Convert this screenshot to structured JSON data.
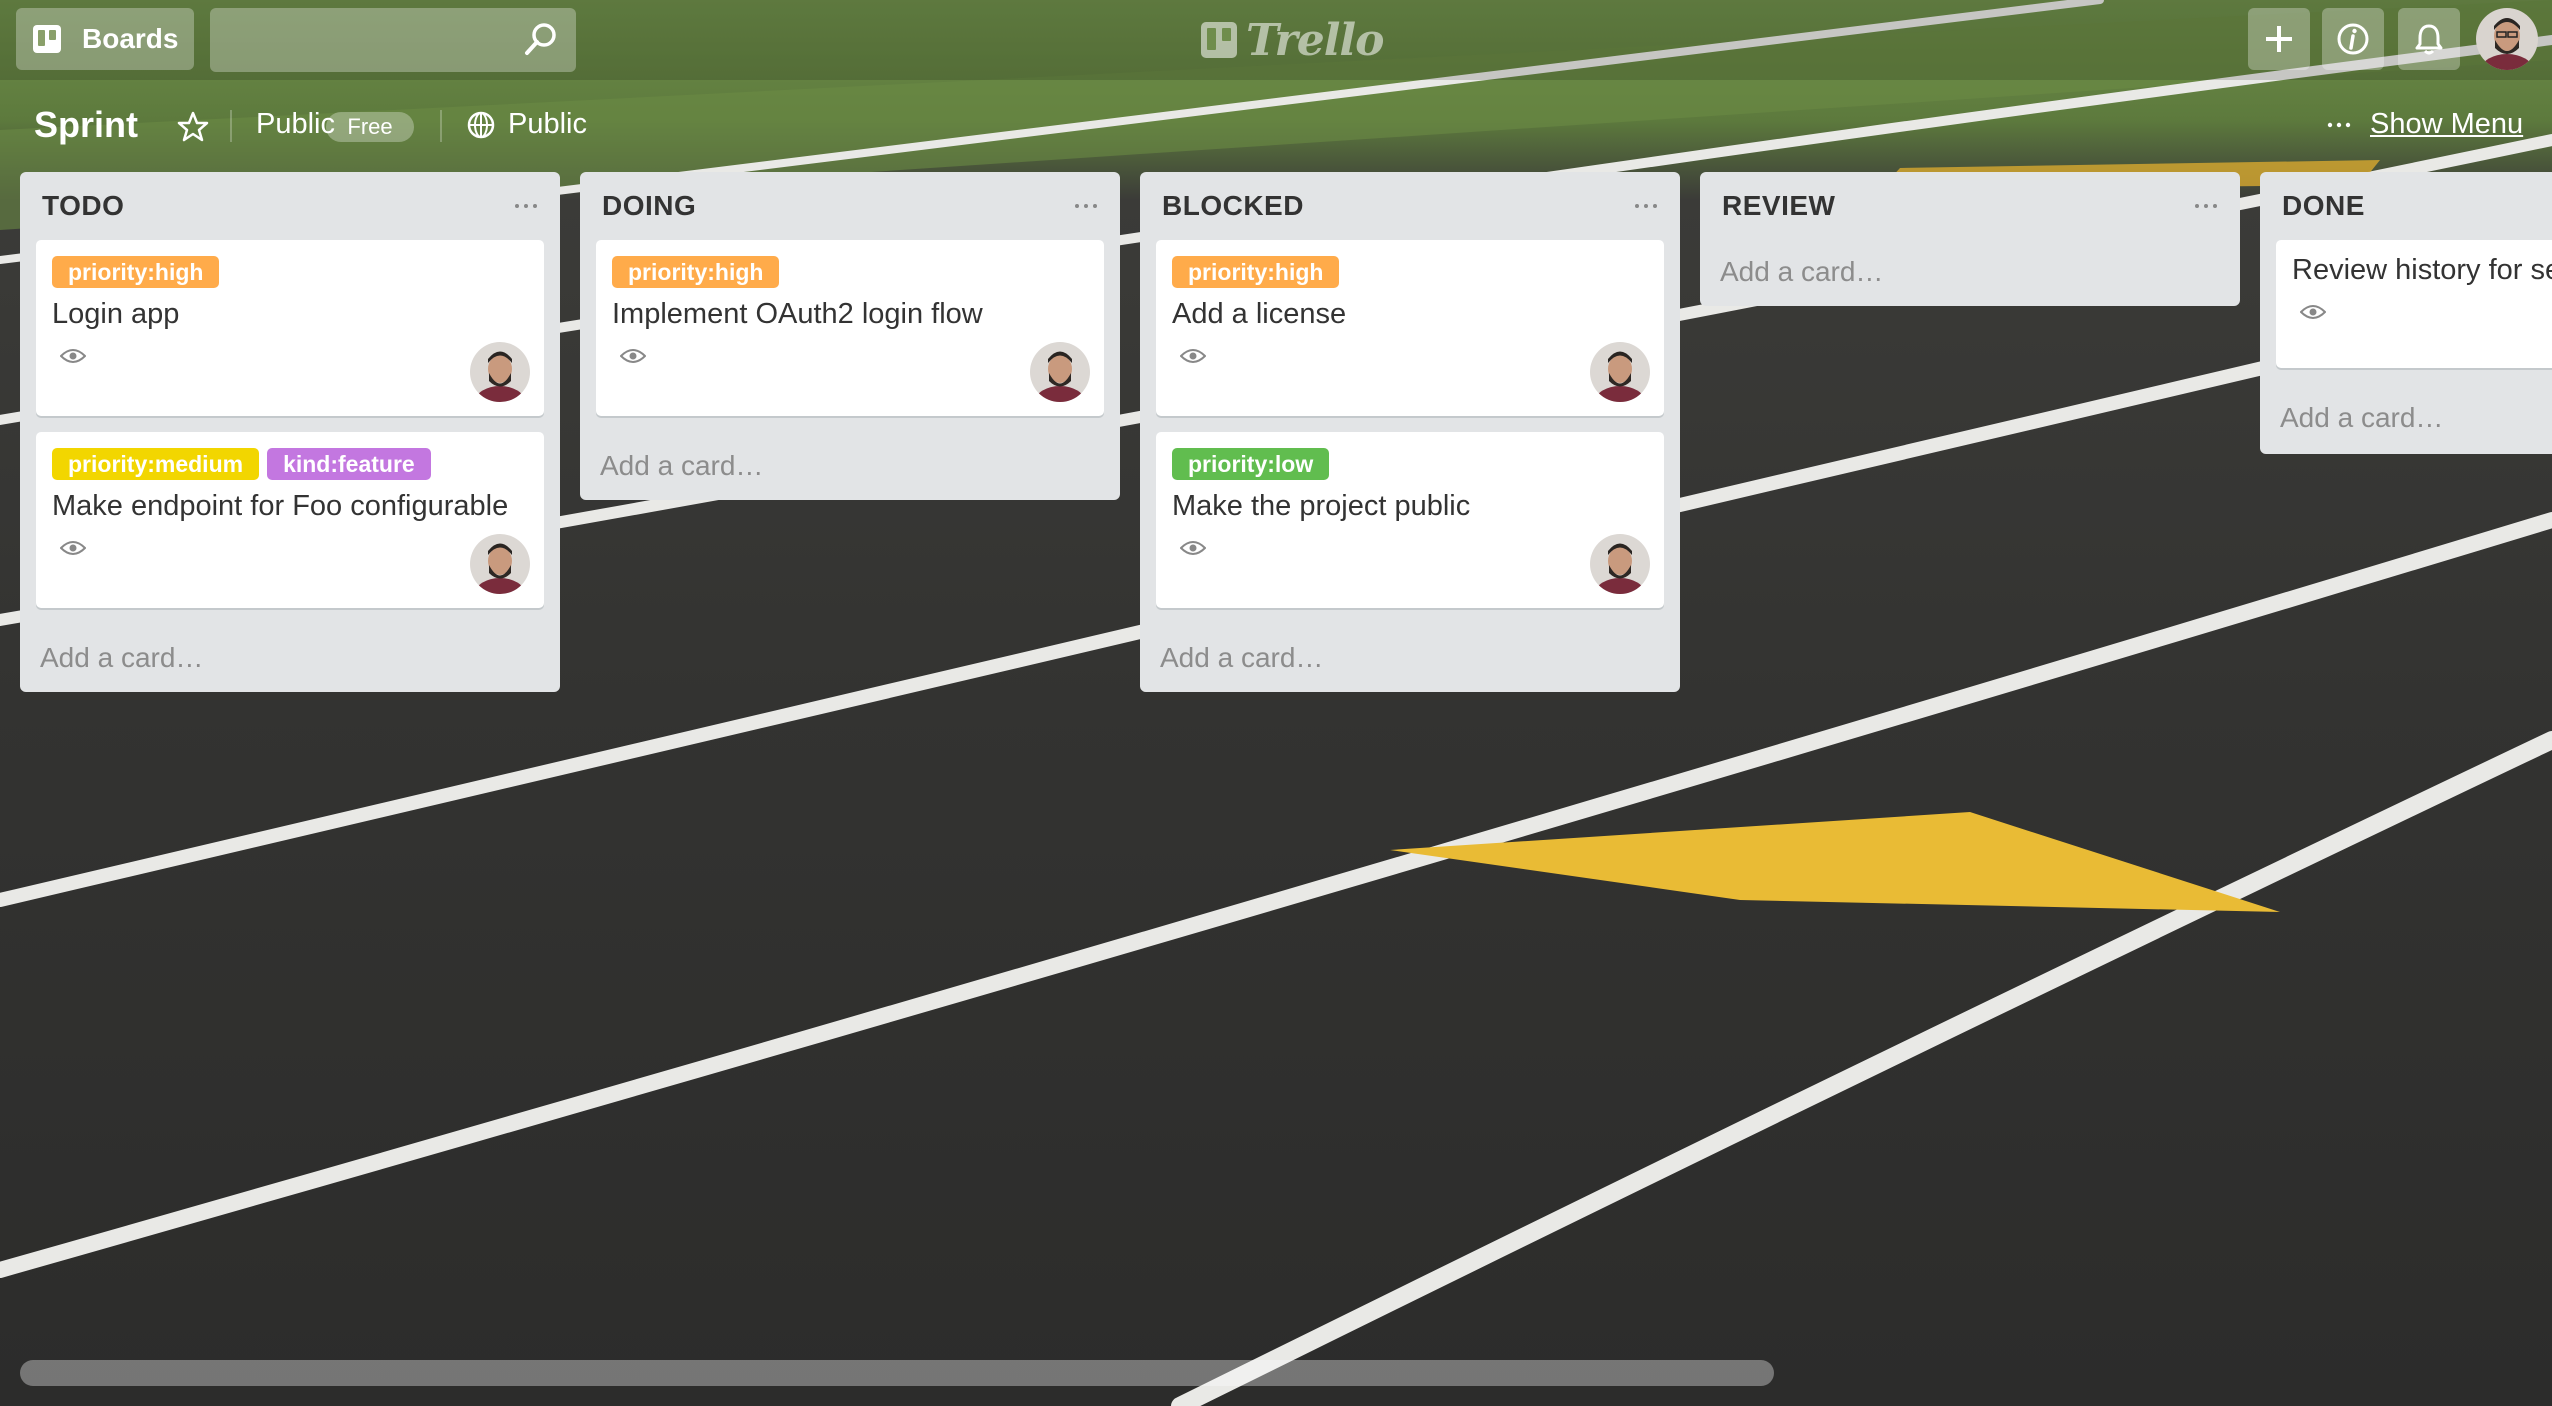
{
  "header": {
    "boards_label": "Boards",
    "search_placeholder": "",
    "logo_text": "Trello",
    "create_icon": "plus-icon",
    "info_icon": "info-icon",
    "notifications_icon": "bell-icon"
  },
  "board": {
    "title": "Sprint",
    "visibility": "Public",
    "plan_badge": "Free",
    "team_visibility": "Public",
    "show_menu": "Show Menu"
  },
  "colors": {
    "label_orange": "#ffab4a",
    "label_yellow": "#f2d600",
    "label_purple": "#c377e0",
    "label_green": "#61bd4f",
    "list_bg": "#e2e4e6"
  },
  "lists": [
    {
      "title": "TODO",
      "cards": [
        {
          "labels": [
            {
              "text": "priority:high",
              "color": "#ffab4a"
            }
          ],
          "title": "Login app"
        },
        {
          "labels": [
            {
              "text": "priority:medium",
              "color": "#f2d600"
            },
            {
              "text": "kind:feature",
              "color": "#c377e0"
            }
          ],
          "title": "Make endpoint for Foo configurable"
        }
      ],
      "add_card": "Add a card…"
    },
    {
      "title": "DOING",
      "cards": [
        {
          "labels": [
            {
              "text": "priority:high",
              "color": "#ffab4a"
            }
          ],
          "title": "Implement OAuth2 login flow"
        }
      ],
      "add_card": "Add a card…"
    },
    {
      "title": "BLOCKED",
      "cards": [
        {
          "labels": [
            {
              "text": "priority:high",
              "color": "#ffab4a"
            }
          ],
          "title": "Add a license"
        },
        {
          "labels": [
            {
              "text": "priority:low",
              "color": "#61bd4f"
            }
          ],
          "title": "Make the project public"
        }
      ],
      "add_card": "Add a card…"
    },
    {
      "title": "REVIEW",
      "cards": [],
      "add_card": "Add a card…"
    },
    {
      "title": "DONE",
      "cards": [
        {
          "labels": [],
          "title": "Review history for se"
        }
      ],
      "add_card": "Add a card…"
    }
  ]
}
